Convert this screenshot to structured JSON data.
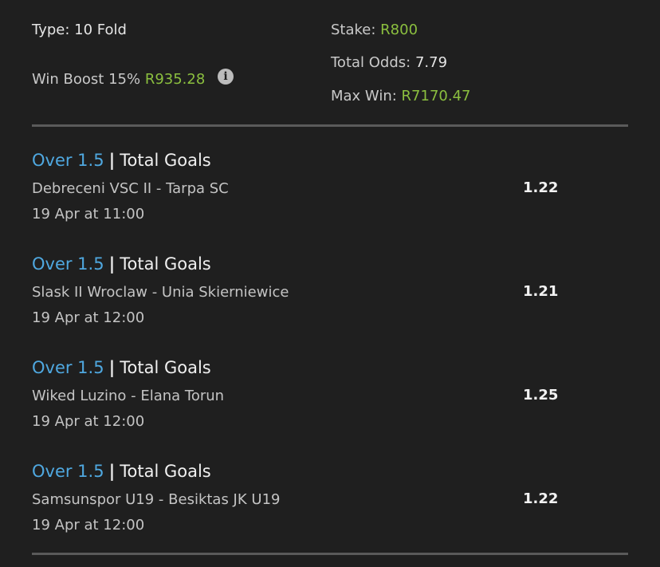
{
  "summary": {
    "type_label": "Type: 10 Fold",
    "boost_label": "Win Boost 15%",
    "boost_value": "R935.28",
    "info_icon": "info-icon",
    "stake_label": "Stake:",
    "stake_value": "R800",
    "odds_label": "Total Odds:",
    "odds_value": "7.79",
    "maxwin_label": "Max Win:",
    "maxwin_value": "R7170.47"
  },
  "bets": [
    {
      "selection": "Over 1.5",
      "separator": "|",
      "market": "Total Goals",
      "match": "Debreceni VSC II - Tarpa SC",
      "time": "19 Apr at 11:00",
      "odds": "1.22"
    },
    {
      "selection": "Over 1.5",
      "separator": "|",
      "market": "Total Goals",
      "match": "Slask II Wroclaw - Unia Skierniewice",
      "time": "19 Apr at 12:00",
      "odds": "1.21"
    },
    {
      "selection": "Over 1.5",
      "separator": "|",
      "market": "Total Goals",
      "match": "Wiked Luzino - Elana Torun",
      "time": "19 Apr at 12:00",
      "odds": "1.25"
    },
    {
      "selection": "Over 1.5",
      "separator": "|",
      "market": "Total Goals",
      "match": "Samsunspor U19 - Besiktas JK U19",
      "time": "19 Apr at 12:00",
      "odds": "1.22"
    }
  ],
  "colors": {
    "background": "#1f1f1f",
    "accent_green": "#8bbf3f",
    "selection_blue": "#4fa8e0"
  }
}
